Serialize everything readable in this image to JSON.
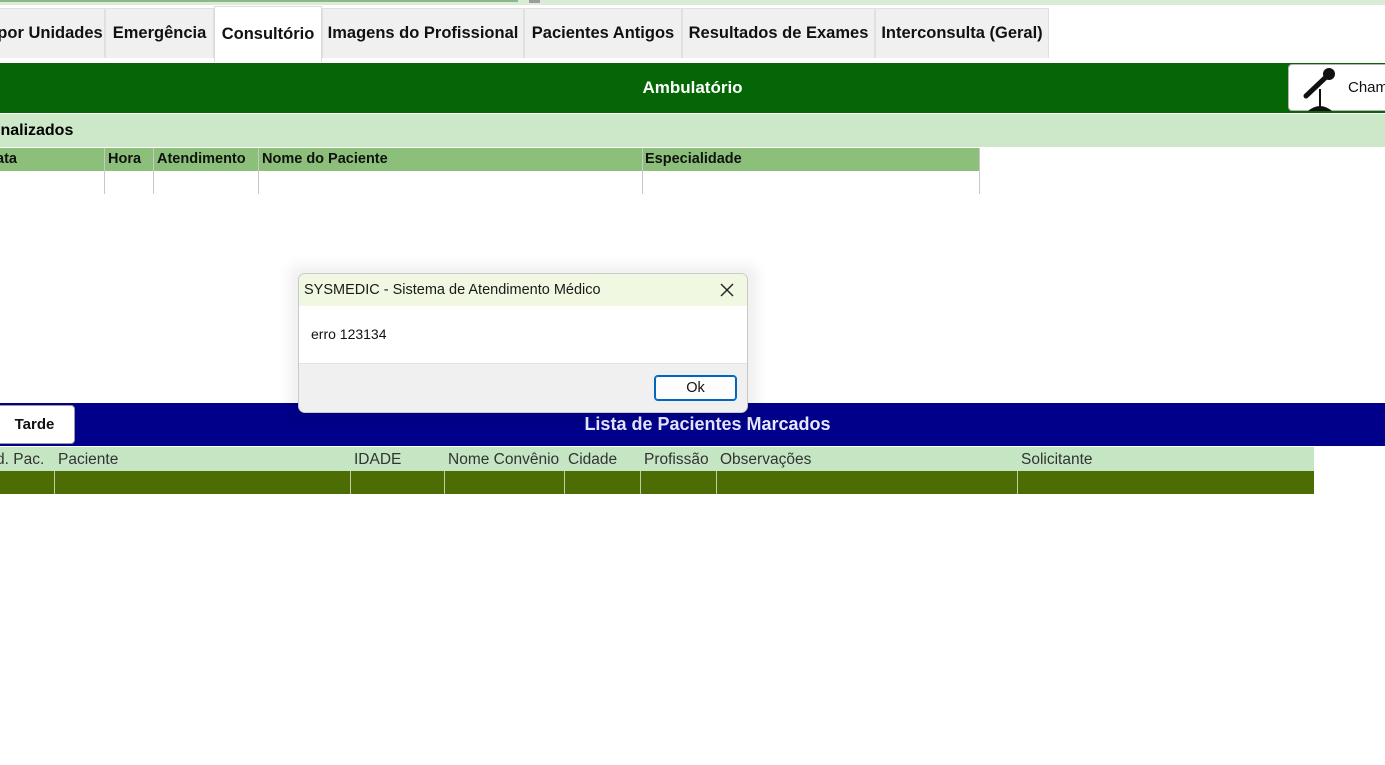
{
  "tabs": [
    {
      "label": "por Unidades",
      "active": false
    },
    {
      "label": "Emergência",
      "active": false
    },
    {
      "label": "Consultório",
      "active": true
    },
    {
      "label": "Imagens do Profissional",
      "active": false
    },
    {
      "label": "Pacientes Antigos",
      "active": false
    },
    {
      "label": "Resultados de Exames",
      "active": false
    },
    {
      "label": "Interconsulta (Geral)",
      "active": false
    }
  ],
  "ambulatorio": {
    "title": "Ambulatório",
    "call_button": {
      "label": "Cham",
      "icon": "microphone-icon"
    }
  },
  "finalizados": {
    "title": "inalizados",
    "columns": [
      "ata",
      "Hora",
      "Atendimento",
      "Nome do Paciente",
      "Especialidade"
    ]
  },
  "marcados": {
    "title": "Lista de Pacientes Marcados",
    "shift_button": "Tarde",
    "columns": [
      "d. Pac.",
      "Paciente",
      "IDADE",
      "Nome Convênio",
      "Cidade",
      "Profissão",
      "Observações",
      "Solicitante"
    ]
  },
  "dialog": {
    "title": "SYSMEDIC - Sistema de Atendimento Médico",
    "message": "erro 123134",
    "ok_label": "Ok",
    "close_icon": "close-icon"
  },
  "colors": {
    "ambulatorio_bar": "#046604",
    "finalizados_bar": "#cde8c9",
    "grid_header": "#8cbf7a",
    "marcados_bar": "#00008b",
    "row_selected": "#4b6d03",
    "ok_border": "#0067c0"
  }
}
